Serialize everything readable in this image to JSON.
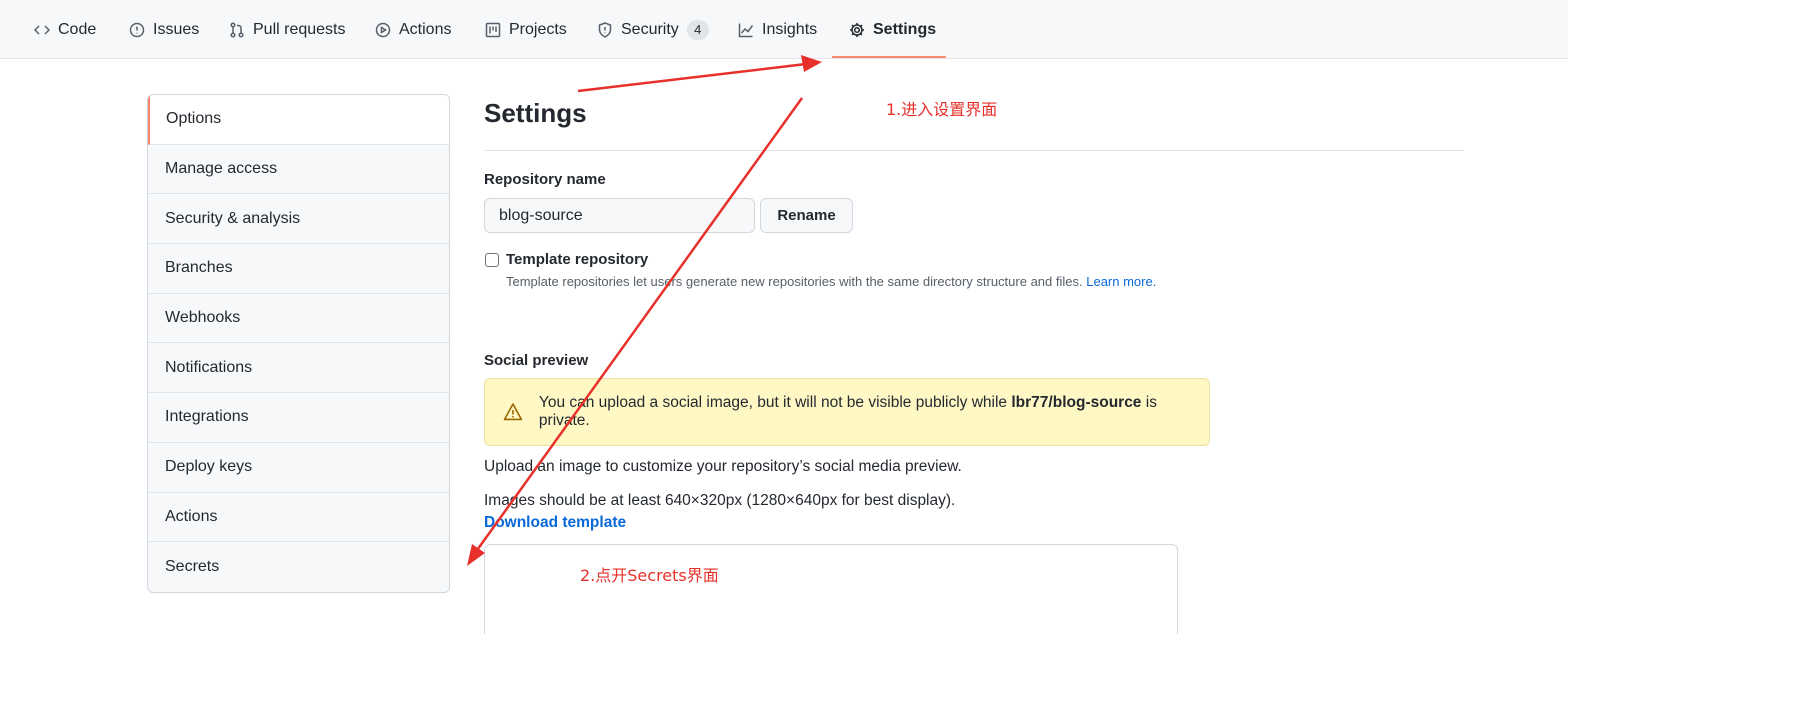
{
  "tabs": [
    {
      "label": "Code",
      "icon": "code-icon"
    },
    {
      "label": "Issues",
      "icon": "issue-icon"
    },
    {
      "label": "Pull requests",
      "icon": "pull-request-icon"
    },
    {
      "label": "Actions",
      "icon": "play-icon"
    },
    {
      "label": "Projects",
      "icon": "project-icon"
    },
    {
      "label": "Security",
      "icon": "shield-icon",
      "counter": "4"
    },
    {
      "label": "Insights",
      "icon": "graph-icon"
    },
    {
      "label": "Settings",
      "icon": "gear-icon",
      "active": true
    }
  ],
  "sidebar": {
    "items": [
      {
        "label": "Options",
        "selected": true
      },
      {
        "label": "Manage access"
      },
      {
        "label": "Security & analysis"
      },
      {
        "label": "Branches"
      },
      {
        "label": "Webhooks"
      },
      {
        "label": "Notifications"
      },
      {
        "label": "Integrations"
      },
      {
        "label": "Deploy keys"
      },
      {
        "label": "Actions"
      },
      {
        "label": "Secrets"
      }
    ]
  },
  "main": {
    "title": "Settings",
    "repo_name_label": "Repository name",
    "repo_name_value": "blog-source",
    "rename_label": "Rename",
    "template_label": "Template repository",
    "template_note": "Template repositories let users generate new repositories with the same directory structure and files.",
    "learn_more": "Learn more.",
    "social_label": "Social preview",
    "flash": {
      "before": "You can upload a social image, but it will not be visible publicly while",
      "repo": "lbr77/blog-source",
      "after": "is private."
    },
    "upload_text": "Upload an image to customize your repository’s social media preview.",
    "size_text": "Images should be at least 640×320px (1280×640px for best display).",
    "download_label": "Download template"
  },
  "annotations": {
    "step1": "1.进入设置界面",
    "step2": "2.点开Secrets界面",
    "color": "#e8302b"
  }
}
